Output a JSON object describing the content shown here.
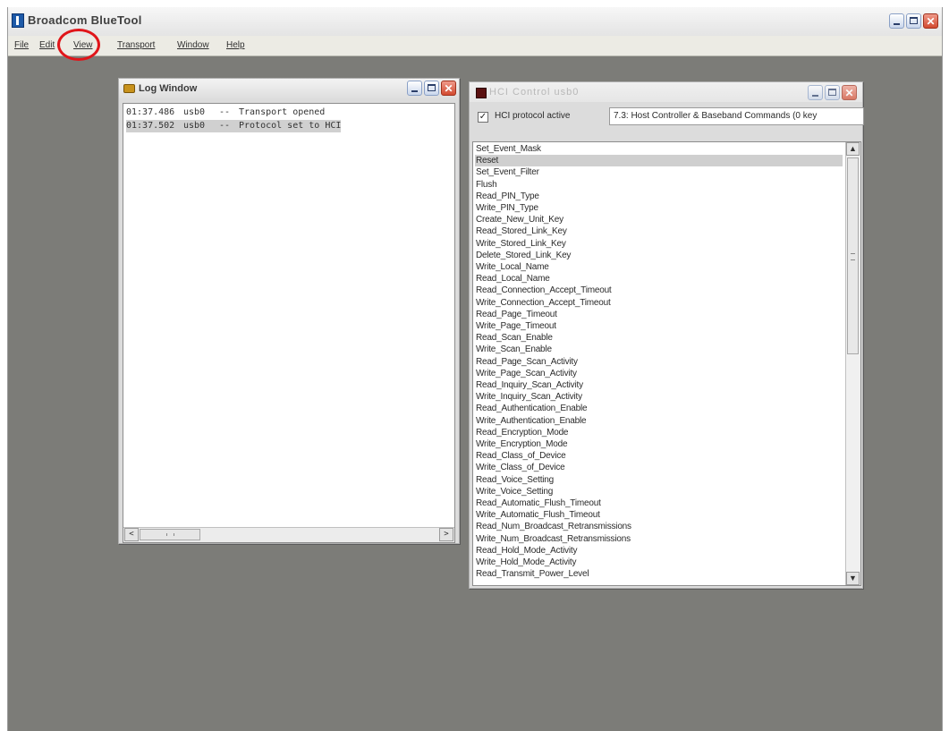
{
  "app": {
    "title": "Broadcom BlueTool",
    "menu": [
      "File",
      "Edit",
      "View",
      "Transport",
      "Window",
      "Help"
    ]
  },
  "log_window": {
    "title": "Log Window",
    "lines": [
      {
        "time": "01:37.486",
        "source": "usb0",
        "sep": "--",
        "message": "Transport opened"
      },
      {
        "time": "01:37.502",
        "source": "usb0",
        "sep": "--",
        "message": "Protocol set to HCI"
      }
    ],
    "selected_index": 1,
    "scroll_left": "<",
    "scroll_right": ">"
  },
  "hci_window": {
    "title": "HCI Control usb0",
    "protocol_checkbox_label": "HCI protocol active",
    "protocol_checked": true,
    "command_group": "7.3: Host Controller & Baseband Commands (0 key",
    "selected_command_index": 1,
    "commands": [
      "Set_Event_Mask",
      "Reset",
      "Set_Event_Filter",
      "Flush",
      "Read_PIN_Type",
      "Write_PIN_Type",
      "Create_New_Unit_Key",
      "Read_Stored_Link_Key",
      "Write_Stored_Link_Key",
      "Delete_Stored_Link_Key",
      "Write_Local_Name",
      "Read_Local_Name",
      "Read_Connection_Accept_Timeout",
      "Write_Connection_Accept_Timeout",
      "Read_Page_Timeout",
      "Write_Page_Timeout",
      "Read_Scan_Enable",
      "Write_Scan_Enable",
      "Read_Page_Scan_Activity",
      "Write_Page_Scan_Activity",
      "Read_Inquiry_Scan_Activity",
      "Write_Inquiry_Scan_Activity",
      "Read_Authentication_Enable",
      "Write_Authentication_Enable",
      "Read_Encryption_Mode",
      "Write_Encryption_Mode",
      "Read_Class_of_Device",
      "Write_Class_of_Device",
      "Read_Voice_Setting",
      "Write_Voice_Setting",
      "Read_Automatic_Flush_Timeout",
      "Write_Automatic_Flush_Timeout",
      "Read_Num_Broadcast_Retransmissions",
      "Write_Num_Broadcast_Retransmissions",
      "Read_Hold_Mode_Activity",
      "Write_Hold_Mode_Activity",
      "Read_Transmit_Power_Level"
    ]
  },
  "colors": {
    "highlight_circle": "#e0151a",
    "mdi_background": "#7c7c78",
    "selection": "#cfcfcf"
  }
}
